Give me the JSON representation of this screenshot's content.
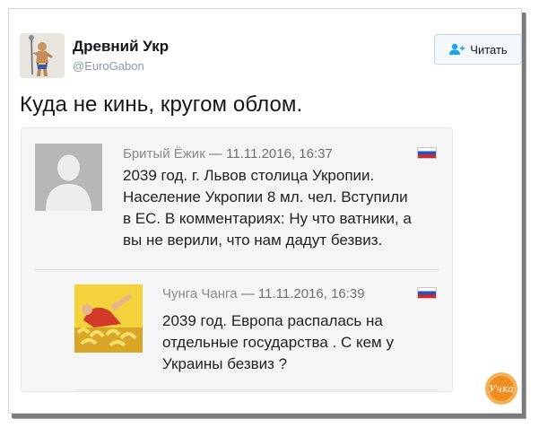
{
  "tweet": {
    "author_name": "Древний Укр",
    "author_handle": "@EuroGabon",
    "follow_label": "Читать",
    "text": "Куда не кинь, кругом облом."
  },
  "comments": [
    {
      "name": "Бритый Ёжик",
      "meta": " — 11.11.2016, 16:37",
      "lines": [
        "2039 год. г. Львов столица Укропии.",
        "Население Укропии 8 мл. чел. Вступили",
        "в ЕС. В комментариях: Ну что ватники, а",
        "вы не верили, что нам дадут безвиз."
      ]
    },
    {
      "name": "Чунга Чанга",
      "meta": " — 11.11.2016, 16:39",
      "lines": [
        "2039 год. Европа распалась на",
        "отдельные государства . С кем у",
        "Украины безвиз ?"
      ]
    }
  ],
  "watermark": {
    "text": "Учка"
  },
  "colors": {
    "flag_white": "#ffffff",
    "flag_blue": "#2a4fbf",
    "flag_red": "#d52b1e",
    "watermark": "#f08a1c"
  }
}
